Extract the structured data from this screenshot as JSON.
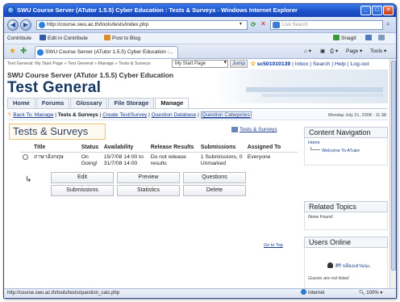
{
  "window": {
    "title": "SWU Course Server (ATutor 1.5.5) Cyber Education : Tests & Surveys - Windows Internet Explorer",
    "buttons": {
      "minimize": "_",
      "maximize": "□",
      "close": "✕"
    }
  },
  "addressbar": {
    "url": "http://course.swu.ac.th/tools/tests/index.php",
    "search_placeholder": "Live Search"
  },
  "linksbar": {
    "contribute": "Contribute",
    "edit_in_contribute": "Edit in Contribute",
    "post_to_blog": "Post to Blog",
    "snagit": "SnagIt"
  },
  "tabbar": {
    "tab_title": "SWU Course Server (ATutor 1.5.5) Cyber Education :...",
    "page_menu": "Page ▾",
    "tools_menu": "Tools ▾"
  },
  "page": {
    "breadcrumb": "Test General: My Start Page » Test General » Manage » Tests & Surveys",
    "jump_select": "My Start Page",
    "jump_button": "Jump",
    "username": "sc501010139",
    "user_links": "| Inbox | Search | Help | Log-out",
    "course_name": "SWU Course Server (ATutor 1.5.5) Cyber Education",
    "course_title": "Test General",
    "main_nav": [
      "Home",
      "Forums",
      "Glossary",
      "File Storage",
      "Manage"
    ],
    "subnav": {
      "back": "Back To: Manage",
      "sep1": "|",
      "current": "Tests & Surveys",
      "sep2": "|",
      "create": "Create Test/Survey",
      "sep3": "|",
      "question_db": "Question Database",
      "sep4": "|",
      "question_cats": "Question Categories",
      "date": "Monday July 21, 2008 - 11:38"
    },
    "heading": "Tests & Surveys",
    "tests_link": "Tests & Surveys",
    "table": {
      "headers": [
        "Title",
        "Status",
        "Availability",
        "Release Results",
        "Submissions",
        "Assigned To"
      ],
      "row": {
        "title": "ภาษาอังกฤษ",
        "status": "On Going!",
        "availability": "15/7/08 14:00 to 31/7/08 14:00",
        "release_results": "Do not release results",
        "submissions": "1 Submissions, 0 Unmarked",
        "assigned_to": "Everyone"
      }
    },
    "buttons": [
      "Edit",
      "Preview",
      "Questions",
      "Submissions",
      "Statistics",
      "Delete"
    ],
    "goto_top": "Go to Top"
  },
  "sidebar": {
    "content_nav": {
      "title": "Content Navigation",
      "home": "Home",
      "welcome": "Welcome To ATutor"
    },
    "related": {
      "title": "Related Topics",
      "none": "None Found"
    },
    "users_online": {
      "title": "Users Online",
      "user": "ศิริ ปล้องเสวนนะ",
      "guests": "Guests are not listed"
    }
  },
  "statusbar": {
    "url": "http://course.swu.ac.th/tools/tests/question_cats.php",
    "zone": "Internet",
    "zoom": "100%"
  }
}
